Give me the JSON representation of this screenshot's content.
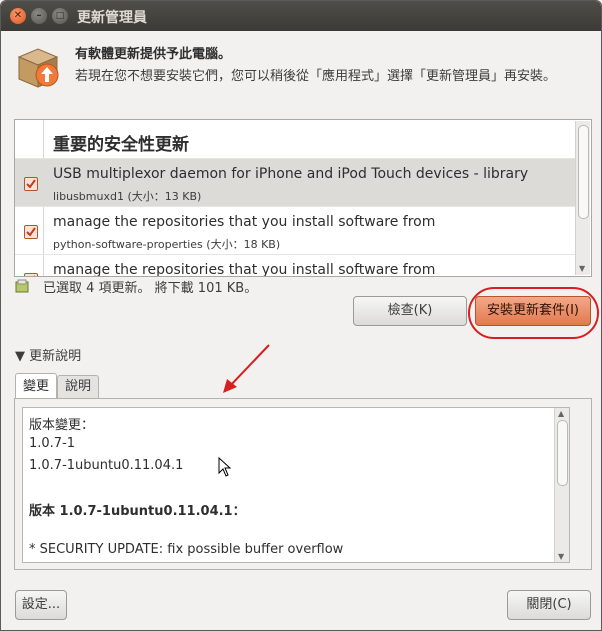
{
  "window": {
    "title": "更新管理員"
  },
  "header": {
    "headline": "有軟體更新提供予此電腦。",
    "description": "若現在您不想要安裝它們，您可以稍後從「應用程式」選擇「更新管理員」再安裝。"
  },
  "updates": {
    "section_title": "重要的安全性更新",
    "items": [
      {
        "name": "USB multiplexor daemon for iPhone and iPod Touch devices - library",
        "size": "libusbmuxd1 (大小：13 KB)",
        "checked": true,
        "selected": true
      },
      {
        "name": "manage the repositories that you install software from",
        "size": "python-software-properties (大小：18 KB)",
        "checked": true,
        "selected": false
      },
      {
        "name": "manage the repositories that you install software from",
        "size": "",
        "checked": true,
        "selected": false
      }
    ]
  },
  "status": {
    "text": "已選取 4 項更新。 將下載 101 KB。"
  },
  "buttons": {
    "check": "檢查(K)",
    "install": "安裝更新套件(I)",
    "settings": "設定...",
    "close": "關閉(C)"
  },
  "details": {
    "expander_label": "更新說明",
    "tabs": [
      "變更",
      "說明"
    ],
    "active_tab": "變更",
    "changelog": [
      "版本變更：",
      "1.0.7-1",
      "1.0.7-1ubuntu0.11.04.1",
      "",
      "版本 1.0.7-1ubuntu0.11.04.1：",
      "",
      " * SECURITY UPDATE: fix possible buffer overflow"
    ]
  },
  "colors": {
    "titlebar": "#3c3b37",
    "accent": "#e2794f",
    "annotation": "#d81e1e"
  },
  "icons": {
    "window_close": "close-icon",
    "package": "package-box-icon",
    "status": "download-status-icon"
  }
}
